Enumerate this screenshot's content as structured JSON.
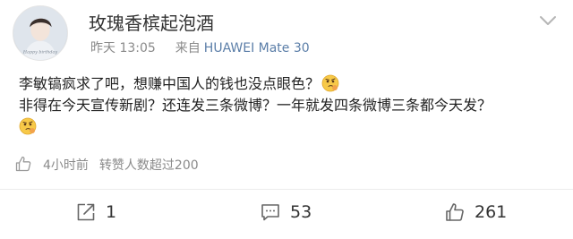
{
  "post": {
    "username": "玫瑰香槟起泡酒",
    "time_label": "昨天 13:05",
    "source_prefix": "来自",
    "device": "HUAWEI Mate 30",
    "content_line1": "李敏镐疯求了吧，想赚中国人的钱也没点眼色？",
    "content_line2": "非得在今天宣传新剧？还连发三条微博？一年就发四条微博三条都今天发？",
    "emoji_name": "thinking-face-emoji",
    "avatar_text": "Happy birthday",
    "activity": {
      "time_ago": "4小时前",
      "repost_count_label": "转赞人数超过200"
    }
  },
  "actions": {
    "share_count": "1",
    "comment_count": "53",
    "like_count": "261"
  },
  "colors": {
    "text": "#222222",
    "meta": "#8a8a8a",
    "link": "#5b7ea8",
    "divider": "#ececec"
  }
}
